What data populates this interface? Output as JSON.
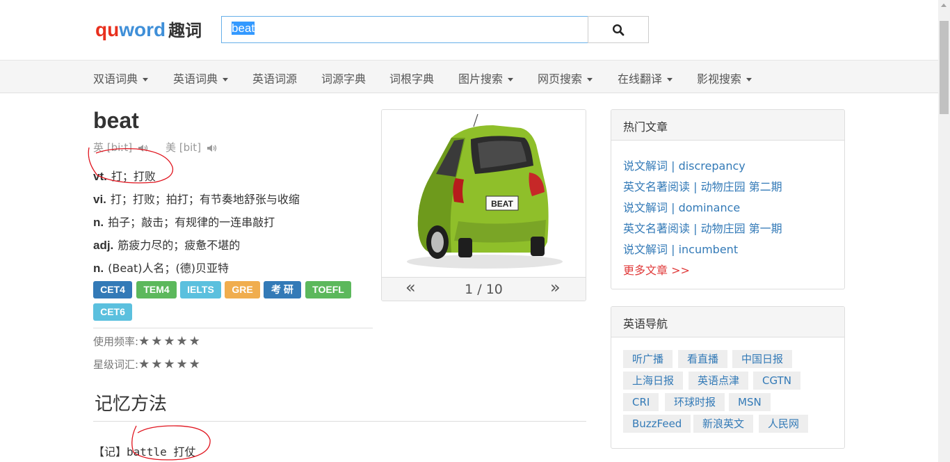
{
  "header": {
    "logo_qu": "qu",
    "logo_word": "word",
    "logo_cn": "趣词",
    "search_value": "beat"
  },
  "nav": {
    "items": [
      "双语词典",
      "英语词典",
      "英语词源",
      "词源字典",
      "词根字典",
      "图片搜索",
      "网页搜索",
      "在线翻译",
      "影视搜索"
    ]
  },
  "entry": {
    "word": "beat",
    "phonetic_uk": "英 [biːt]",
    "phonetic_us": "美 [bit]",
    "definitions": [
      {
        "pos": "vt.",
        "text": "打；打败"
      },
      {
        "pos": "vi.",
        "text": "打；打败；拍打；有节奏地舒张与收缩"
      },
      {
        "pos": "n.",
        "text": "拍子；敲击；有规律的一连串敲打"
      },
      {
        "pos": "adj.",
        "text": "筋疲力尽的；疲惫不堪的"
      },
      {
        "pos": "n.",
        "text": "(Beat)人名；(德)贝亚特"
      }
    ],
    "tags": [
      {
        "label": "CET4",
        "color": "#337ab7"
      },
      {
        "label": "TEM4",
        "color": "#5cb85c"
      },
      {
        "label": "IELTS",
        "color": "#5bc0de"
      },
      {
        "label": "GRE",
        "color": "#f0ad4e"
      },
      {
        "label": "考 研",
        "color": "#337ab7"
      },
      {
        "label": "TOEFL",
        "color": "#5cb85c"
      },
      {
        "label": "CET6",
        "color": "#5bc0de"
      }
    ],
    "frequency_label": "使用频率:",
    "frequency_stars": "★★★★★",
    "level_label": "星级词汇:",
    "level_stars": "★★★★★"
  },
  "image_card": {
    "plate_text": "BEAT",
    "prev": "«",
    "next": "»",
    "page": "1 / 10"
  },
  "memo": {
    "title": "记忆方法",
    "prefix": "【记】",
    "text": "battle 打仗"
  },
  "hot_articles": {
    "title": "热门文章",
    "items": [
      "说文解词 | discrepancy",
      "英文名著阅读 | 动物庄园 第二期",
      "说文解词 | dominance",
      "英文名著阅读 | 动物庄园 第一期",
      "说文解词 | incumbent"
    ],
    "more": "更多文章 >>"
  },
  "english_nav": {
    "title": "英语导航",
    "rows": [
      [
        "听广播",
        "看直播",
        "中国日报"
      ],
      [
        "上海日报",
        "英语点津",
        "CGTN"
      ],
      [
        "CRI",
        "环球时报",
        "MSN"
      ],
      [
        "BuzzFeed",
        "新浪英文",
        "人民网"
      ]
    ]
  },
  "colors": {
    "link": "#337ab7",
    "logo_red": "#e8301e",
    "logo_blue": "#3f8fd8",
    "annotation": "#e0141e",
    "more_link": "#e03a3a"
  }
}
